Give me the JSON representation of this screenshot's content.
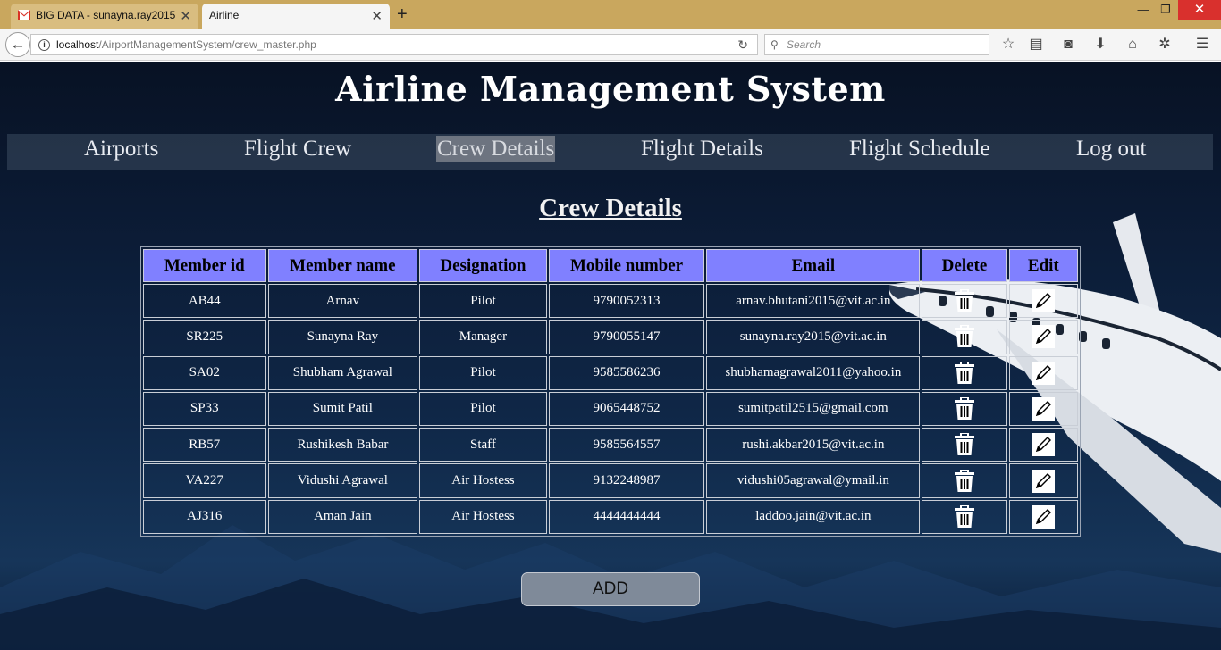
{
  "browser": {
    "tabs": [
      {
        "title": "BIG DATA - sunayna.ray2015",
        "active": false
      },
      {
        "title": "Airline",
        "active": true
      }
    ],
    "url_host": "localhost",
    "url_path": "/AirportManagementSystem/crew_master.php",
    "search_placeholder": "Search",
    "toolbar_icons": [
      "star-icon",
      "reading-list-icon",
      "pocket-icon",
      "download-icon",
      "home-icon",
      "extension-icon",
      "menu-icon"
    ]
  },
  "site": {
    "title": "Airline Management System",
    "menu": [
      {
        "label": "Airports",
        "active": false
      },
      {
        "label": "Flight Crew",
        "active": false
      },
      {
        "label": "Crew Details",
        "active": true
      },
      {
        "label": "Flight Details",
        "active": false
      },
      {
        "label": "Flight Schedule",
        "active": false
      },
      {
        "label": "Log out",
        "active": false
      }
    ]
  },
  "crew": {
    "heading": "Crew Details",
    "columns": [
      "Member id",
      "Member name",
      "Designation",
      "Mobile number",
      "Email",
      "Delete",
      "Edit"
    ],
    "rows": [
      [
        "AB44",
        "Arnav",
        "Pilot",
        "9790052313",
        "arnav.bhutani2015@vit.ac.in"
      ],
      [
        "SR225",
        "Sunayna Ray",
        "Manager",
        "9790055147",
        "sunayna.ray2015@vit.ac.in"
      ],
      [
        "SA02",
        "Shubham Agrawal",
        "Pilot",
        "9585586236",
        "shubhamagrawal2011@yahoo.in"
      ],
      [
        "SP33",
        "Sumit Patil",
        "Pilot",
        "9065448752",
        "sumitpatil2515@gmail.com"
      ],
      [
        "RB57",
        "Rushikesh Babar",
        "Staff",
        "9585564557",
        "rushi.akbar2015@vit.ac.in"
      ],
      [
        "VA227",
        "Vidushi Agrawal",
        "Air Hostess",
        "9132248987",
        "vidushi05agrawal@ymail.in"
      ],
      [
        "AJ316",
        "Aman Jain",
        "Air Hostess",
        "4444444444",
        "laddoo.jain@vit.ac.in"
      ]
    ],
    "add_label": "ADD"
  },
  "colors": {
    "header_bg": "#8080ff",
    "tabbar": "#c9a75e",
    "page_bg": "#0b1a33"
  }
}
